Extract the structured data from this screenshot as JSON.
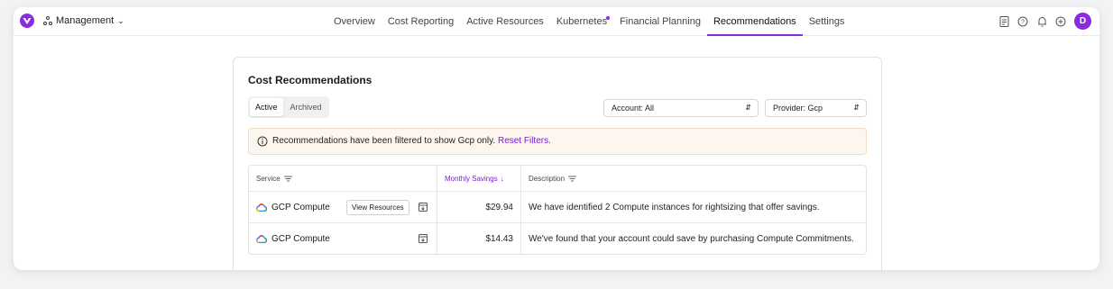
{
  "header": {
    "org_label": "Management",
    "tabs": [
      {
        "label": "Overview"
      },
      {
        "label": "Cost Reporting"
      },
      {
        "label": "Active Resources"
      },
      {
        "label": "Kubernetes"
      },
      {
        "label": "Financial Planning"
      },
      {
        "label": "Recommendations"
      },
      {
        "label": "Settings"
      }
    ],
    "active_tab": "Recommendations",
    "avatar_initial": "D",
    "accent_color": "#8a2be2",
    "icons": [
      "docs-icon",
      "help-icon",
      "bell-icon",
      "plus-circle-icon"
    ]
  },
  "card": {
    "title": "Cost Recommendations",
    "segment": {
      "active_label": "Active",
      "archived_label": "Archived"
    },
    "account_select": "Account: All",
    "provider_select": "Provider: Gcp",
    "banner": {
      "text": "Recommendations have been filtered to show Gcp only.",
      "link": "Reset Filters."
    }
  },
  "table": {
    "headers": {
      "service": "Service",
      "savings": "Monthly Savings",
      "description": "Description"
    },
    "rows": [
      {
        "service": "GCP Compute",
        "action": "View Resources",
        "savings": "$29.94",
        "description": "We have identified 2 Compute instances for rightsizing that offer savings."
      },
      {
        "service": "GCP Compute",
        "savings": "$14.43",
        "description": "We've found that your account could save by purchasing Compute Commitments."
      }
    ]
  }
}
